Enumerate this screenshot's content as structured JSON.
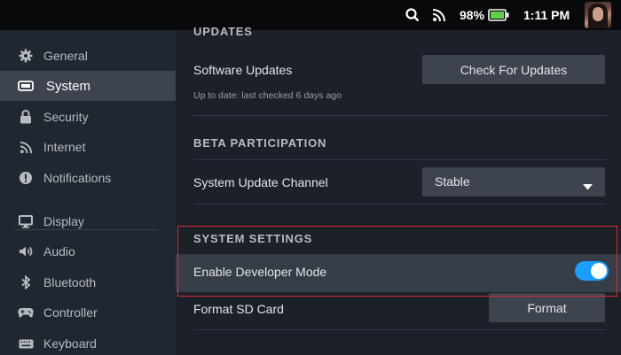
{
  "status_bar": {
    "battery_percent": "98%",
    "time": "1:11 PM",
    "icons": [
      "search-icon",
      "wifi-icon",
      "battery-icon"
    ]
  },
  "sidebar": {
    "items": [
      {
        "label": "General",
        "icon": "gear-icon"
      },
      {
        "label": "System",
        "icon": "system-icon"
      },
      {
        "label": "Security",
        "icon": "lock-icon"
      },
      {
        "label": "Internet",
        "icon": "wifi-icon"
      },
      {
        "label": "Notifications",
        "icon": "info-icon"
      },
      {
        "label": "Display",
        "icon": "monitor-icon"
      },
      {
        "label": "Audio",
        "icon": "speaker-icon"
      },
      {
        "label": "Bluetooth",
        "icon": "bluetooth-icon"
      },
      {
        "label": "Controller",
        "icon": "gamepad-icon"
      },
      {
        "label": "Keyboard",
        "icon": "keyboard-icon"
      }
    ],
    "active": "System"
  },
  "main": {
    "updates": {
      "heading": "UPDATES",
      "software_updates_label": "Software Updates",
      "check_button": "Check For Updates",
      "status": "Up to date: last checked 6 days ago"
    },
    "beta": {
      "heading": "BETA PARTICIPATION",
      "channel_label": "System Update Channel",
      "channel_value": "Stable"
    },
    "system_settings": {
      "heading": "SYSTEM SETTINGS",
      "dev_mode_label": "Enable Developer Mode",
      "dev_mode_enabled": true,
      "format_label": "Format SD Card",
      "format_button": "Format"
    }
  },
  "colors": {
    "accent": "#1a9fff",
    "highlight_border": "#e0282e",
    "battery": "#5fd14a"
  }
}
